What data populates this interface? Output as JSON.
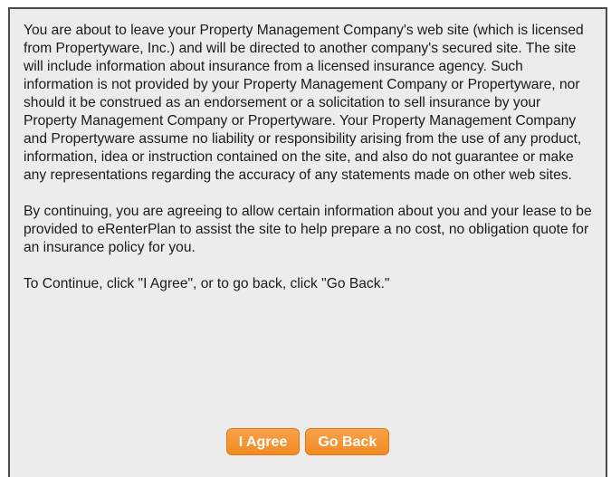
{
  "dialog": {
    "paragraphs": [
      "You are about to leave your Property Management Company's web site (which is licensed from Propertyware, Inc.) and will be directed to another company's secured site. The site will include information about insurance from a licensed insurance agency. Such information is not provided by your Property Management Company or Propertyware, nor should it be construed as an endorsement or a solicitation to sell insurance by your Property Management Company or Propertyware. Your Property Management Company and Propertyware assume no liability or responsibility arising from the use of any product, information, idea or instruction contained on the site, and also do not guarantee or make any representations regarding the accuracy of any statements made on other web sites.",
      "By continuing, you are agreeing to allow certain information about you and your lease to be provided to eRenterPlan to assist the site to help prepare a no cost, no obligation quote for an insurance policy for you.",
      "To Continue, click \"I Agree\", or to go back, click \"Go Back.\""
    ],
    "buttons": {
      "agree_label": "I Agree",
      "back_label": "Go Back"
    }
  },
  "colors": {
    "button_orange": "#f28a23",
    "dialog_background": "#ececec",
    "border": "#4a4a4a"
  }
}
